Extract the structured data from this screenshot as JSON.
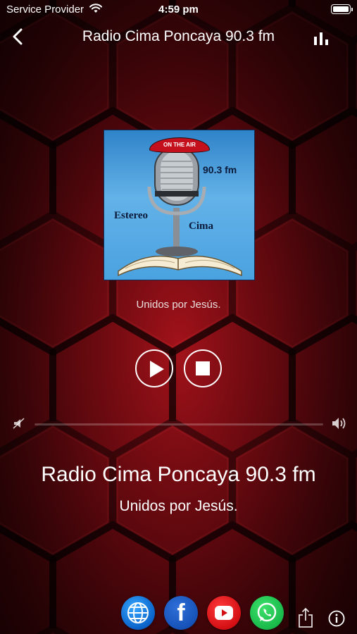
{
  "status_bar": {
    "carrier": "Service Provider",
    "time": "4:59 pm",
    "wifi_icon": "wifi-icon",
    "battery_icon": "battery-icon"
  },
  "nav": {
    "title": "Radio Cima Poncaya 90.3 fm",
    "back_icon": "chevron-left-icon",
    "equalizer_icon": "bar-chart-icon"
  },
  "artwork": {
    "on_air": "ON THE AIR",
    "frequency": "90.3 fm",
    "brand_left": "Estereo",
    "brand_right": "Cima",
    "caption": "Unidos por Jesús."
  },
  "controls": {
    "play_icon": "play-icon",
    "stop_icon": "stop-icon"
  },
  "volume": {
    "min_icon": "volume-mute-icon",
    "max_icon": "volume-max-icon",
    "level": 0
  },
  "now_playing": {
    "station": "Radio Cima Poncaya 90.3 fm",
    "slogan": "Unidos por Jesús."
  },
  "bottom_bar": {
    "items": [
      {
        "icon": "globe-icon",
        "color": "#0a62c9"
      },
      {
        "icon": "facebook-icon",
        "label": "f",
        "color": "#1652b8"
      },
      {
        "icon": "youtube-icon",
        "color": "#d40f14"
      },
      {
        "icon": "whatsapp-icon",
        "color": "#19b94a"
      }
    ],
    "share_icon": "share-icon",
    "info_icon": "info-icon"
  },
  "colors": {
    "background": "#7a0b12",
    "text": "#ffffff"
  }
}
